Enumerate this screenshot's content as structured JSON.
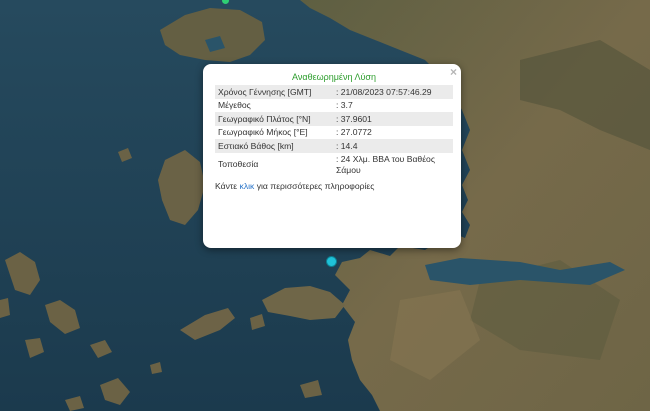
{
  "popup": {
    "title": "Αναθεωρημένη Λύση",
    "rows": [
      {
        "label": "Χρόνος Γέννησης [GMT]",
        "value": ": 21/08/2023 07:57:46.29"
      },
      {
        "label": "Μέγεθος",
        "value": ": 3.7"
      },
      {
        "label": "Γεωγραφικό Πλάτος [°N]",
        "value": ": 37.9601"
      },
      {
        "label": "Γεωγραφικό Μήκος [°E]",
        "value": ": 27.0772"
      },
      {
        "label": "Εστιακό Βάθος [km]",
        "value": ": 14.4"
      },
      {
        "label": "Τοποθεσία",
        "value": ": 24 Χλμ. ΒΒΑ του Βαθέος Σάμου"
      }
    ],
    "footer_pre": "Κάντε ",
    "footer_link": "κλικ",
    "footer_post": " για περισσότερες πληροφορίες",
    "close_symbol": "×"
  },
  "colors": {
    "sea": "#1f3f52",
    "land": "#6b6548",
    "title_green": "#2e9e2e",
    "link_blue": "#2a75c9",
    "marker": "#1fc2d8"
  },
  "icons": {
    "close": "close-icon",
    "marker": "earthquake-marker-icon"
  }
}
